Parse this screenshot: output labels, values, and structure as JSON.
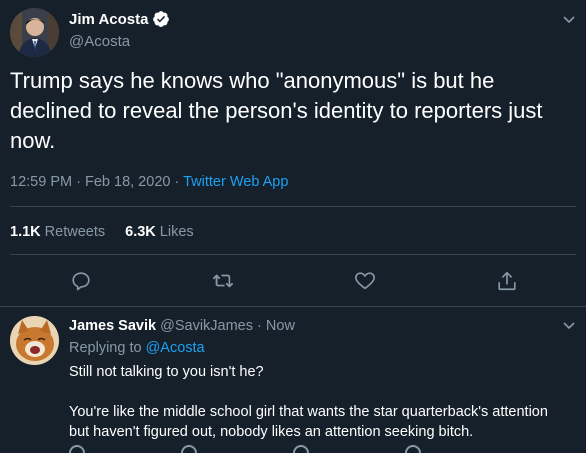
{
  "main_tweet": {
    "author_name": "Jim Acosta",
    "author_handle": "@Acosta",
    "text": "Trump says he knows who \"anonymous\" is but he declined to reveal the person's identity to reporters just now.",
    "time": "12:59 PM",
    "date": "Feb 18, 2020",
    "source": "Twitter Web App",
    "retweets_count": "1.1K",
    "retweets_label": "Retweets",
    "likes_count": "6.3K",
    "likes_label": "Likes"
  },
  "reply": {
    "author_name": "James Savik",
    "author_handle": "@SavikJames",
    "time": "Now",
    "replying_to_label": "Replying to",
    "replying_to_handle": "@Acosta",
    "line1": "Still not talking to you isn't he?",
    "line2": "",
    "line3": "You're like the middle school girl that wants the star quarterback's attention",
    "line4": "but haven't figured out, nobody likes an attention seeking bitch."
  },
  "separator": "·",
  "colors": {
    "background": "#15202b",
    "text": "#ffffff",
    "muted": "#8899a6",
    "accent": "#1da1f2",
    "divider": "#38444d"
  },
  "icons": {
    "verified": "verified-badge-icon",
    "caret": "chevron-down-icon",
    "reply": "reply-icon",
    "retweet": "retweet-icon",
    "like": "heart-icon",
    "share": "share-icon"
  }
}
